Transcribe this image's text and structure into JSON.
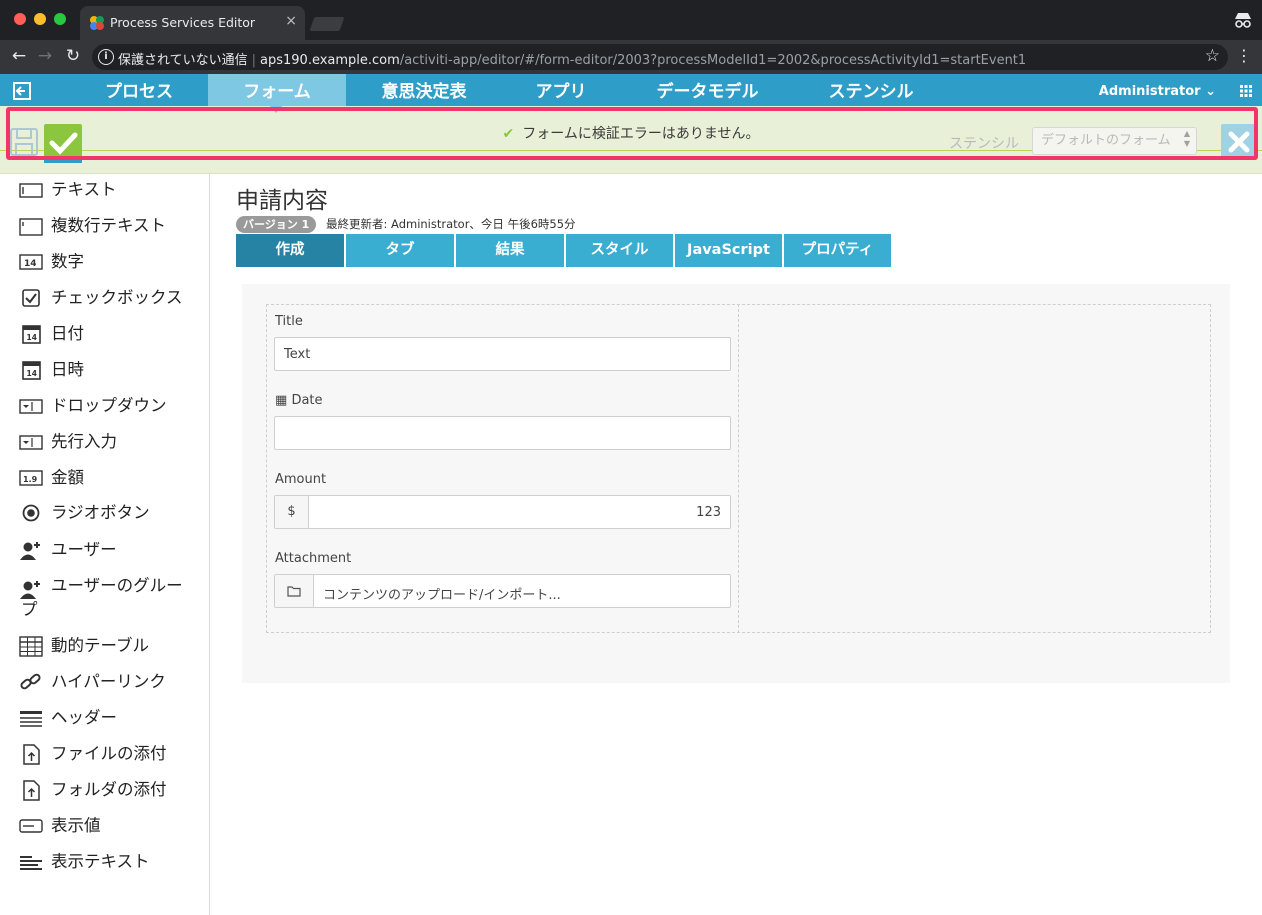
{
  "browser": {
    "tab_title": "Process Services Editor",
    "tab_close": "×",
    "url_security": "保護されていない通信",
    "url_host": "aps190.example.com",
    "url_path": "/activiti-app/editor/#/form-editor/2003?processModelId1=2002&processActivityId1=startEvent1"
  },
  "app_nav": {
    "items": [
      {
        "label": "プロセス"
      },
      {
        "label": "フォーム"
      },
      {
        "label": "意思決定表"
      },
      {
        "label": "アプリ"
      },
      {
        "label": "データモデル"
      },
      {
        "label": "ステンシル"
      }
    ],
    "active": "フォーム",
    "user": "Administrator"
  },
  "editor_toolbar": {
    "validation_message": "フォームに検証エラーはありません。",
    "stencil_label": "ステンシル",
    "stencil_value": "デフォルトのフォーム"
  },
  "palette": {
    "items": [
      {
        "label": "テキスト",
        "icon": "text-field-icon"
      },
      {
        "label": "複数行テキスト",
        "icon": "multiline-text-icon"
      },
      {
        "label": "数字",
        "icon": "number-icon"
      },
      {
        "label": "チェックボックス",
        "icon": "checkbox-icon"
      },
      {
        "label": "日付",
        "icon": "calendar-icon"
      },
      {
        "label": "日時",
        "icon": "calendar-time-icon"
      },
      {
        "label": "ドロップダウン",
        "icon": "dropdown-icon"
      },
      {
        "label": "先行入力",
        "icon": "typeahead-icon"
      },
      {
        "label": "金額",
        "icon": "amount-icon"
      },
      {
        "label": "ラジオボタン",
        "icon": "radio-icon"
      },
      {
        "label": "ユーザー",
        "icon": "user-add-icon"
      },
      {
        "label": "ユーザーのグルー",
        "label2": "プ",
        "icon": "group-add-icon"
      },
      {
        "label": "動的テーブル",
        "icon": "table-icon"
      },
      {
        "label": "ハイパーリンク",
        "icon": "link-icon"
      },
      {
        "label": "ヘッダー",
        "icon": "header-icon"
      },
      {
        "label": "ファイルの添付",
        "icon": "file-attach-icon"
      },
      {
        "label": "フォルダの添付",
        "icon": "folder-attach-icon"
      },
      {
        "label": "表示値",
        "icon": "display-value-icon"
      },
      {
        "label": "表示テキスト",
        "icon": "display-text-icon"
      }
    ]
  },
  "form": {
    "title": "申請内容",
    "version_badge": "バージョン 1",
    "modified": "最終更新者: Administrator、今日 午後6時55分",
    "tabs": [
      {
        "label": "作成"
      },
      {
        "label": "タブ"
      },
      {
        "label": "結果"
      },
      {
        "label": "スタイル"
      },
      {
        "label": "JavaScript"
      },
      {
        "label": "プロパティ"
      }
    ],
    "active_tab": "作成",
    "fields": {
      "title_label": "Title",
      "title_value": "Text",
      "date_label": "Date",
      "date_value": "",
      "amount_label": "Amount",
      "amount_currency": "$",
      "amount_value": "123",
      "attachment_label": "Attachment",
      "attachment_value": "コンテンツのアップロード/インポート..."
    }
  },
  "colors": {
    "nav_bg": "#2e9ec9",
    "nav_active": "#7fc8e3",
    "validation_bg": "#e9f0d8",
    "validate_green": "#8cc63f",
    "highlight": "#f0356b",
    "tab_bg": "#3aaed0",
    "tab_active": "#2783a3"
  }
}
